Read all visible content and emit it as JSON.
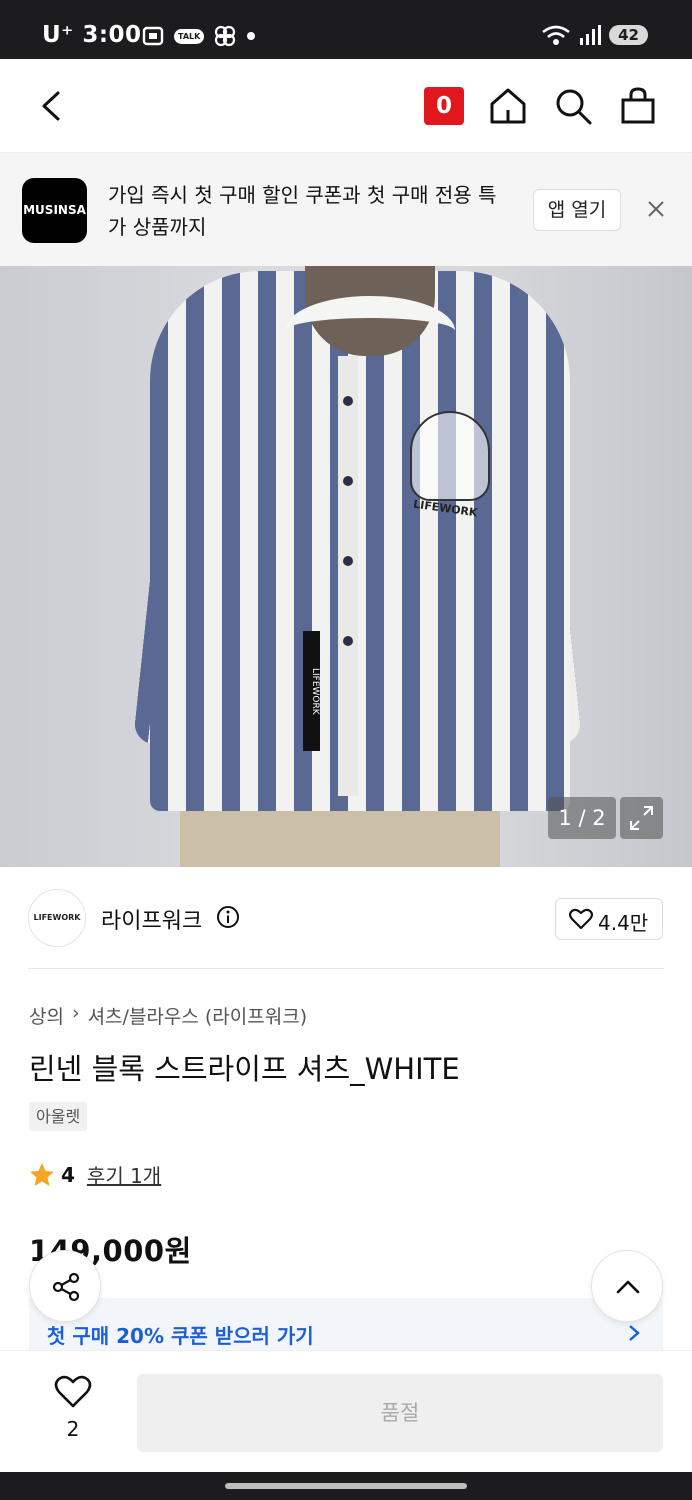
{
  "status_bar": {
    "carrier": "U⁺",
    "time": "3:00",
    "talk_badge": "TALK",
    "battery": "42"
  },
  "header": {
    "cart_count": "0"
  },
  "promo": {
    "logo_text": "MUSINSA",
    "message": "가입 즉시 첫 구매 할인 쿠폰과 첫 구매 전용 특가 상품까지",
    "open_app_label": "앱 열기"
  },
  "gallery": {
    "counter": "1 / 2",
    "print_brand": "LIFEWORK",
    "tape_text": "LIFEWORK"
  },
  "brand": {
    "logo_text": "LIFEWORK",
    "name": "라이프워크",
    "likes": "4.4만"
  },
  "product": {
    "breadcrumbs": [
      "상의",
      "셔츠/블라우스 (라이프워크)"
    ],
    "title": "린넨 블록 스트라이프 셔츠_WHITE",
    "tag": "아울렛",
    "rating": "4",
    "reviews": "후기 1개",
    "price": "149,000원"
  },
  "coupon": {
    "text": "첫 구매 20% 쿠폰 받으러 가기"
  },
  "bottom_bar": {
    "wish_count": "2",
    "soldout_label": "품절"
  },
  "colors": {
    "accent_red": "#e1171e",
    "coupon_blue": "#1a5fd6",
    "star": "#f5a623"
  }
}
